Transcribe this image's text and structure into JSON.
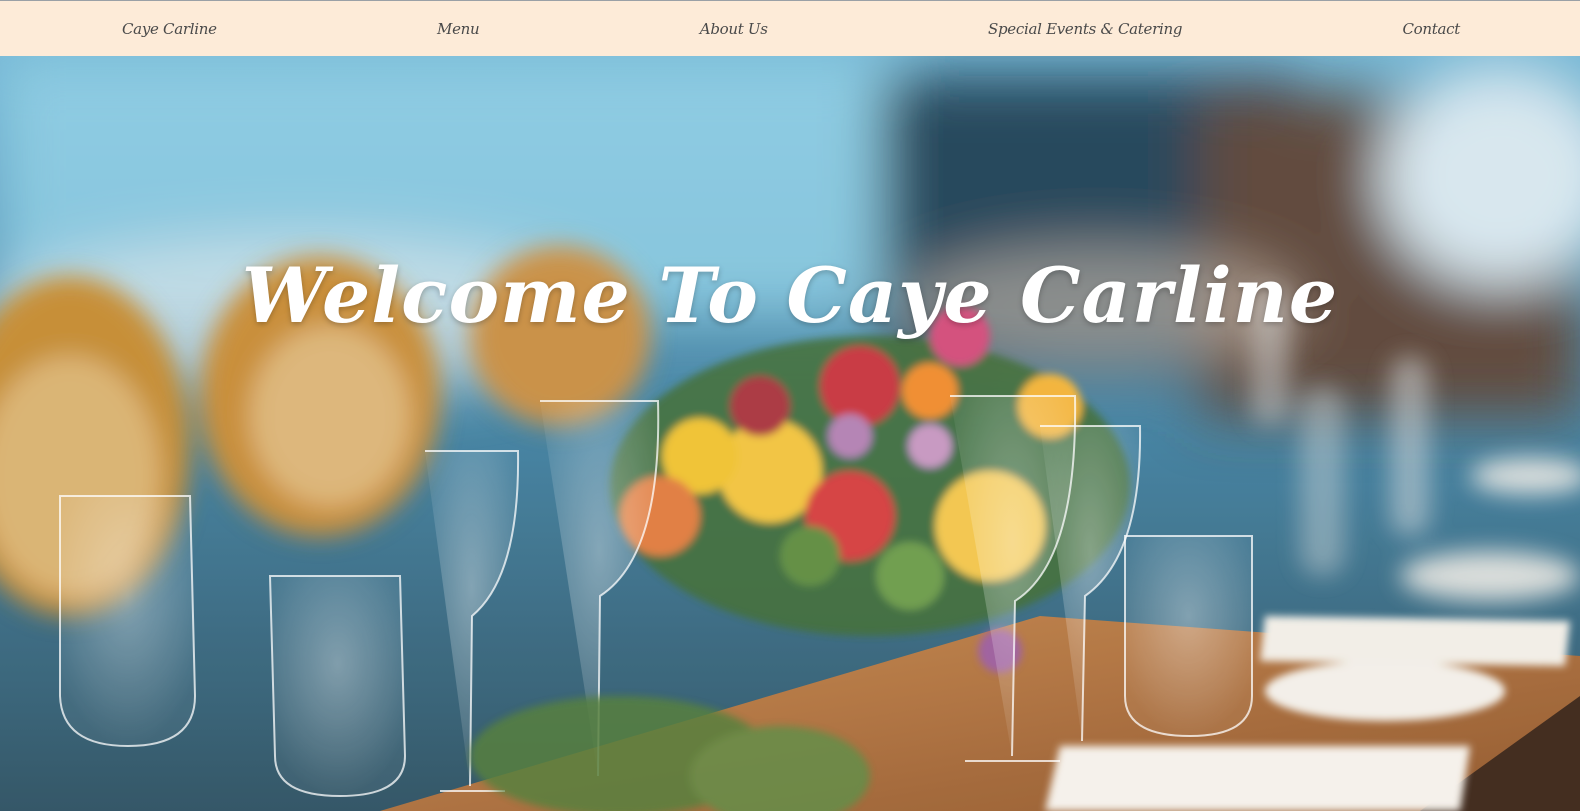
{
  "nav": {
    "items": [
      {
        "label": "Caye Carline"
      },
      {
        "label": "Menu"
      },
      {
        "label": "About Us"
      },
      {
        "label": "Special Events & Catering"
      },
      {
        "label": "Contact"
      }
    ]
  },
  "hero": {
    "title": "Welcome To Caye Carline"
  },
  "colors": {
    "nav_background": "#fdebd8",
    "nav_text": "#4a4a4a",
    "hero_title": "#ffffff"
  }
}
